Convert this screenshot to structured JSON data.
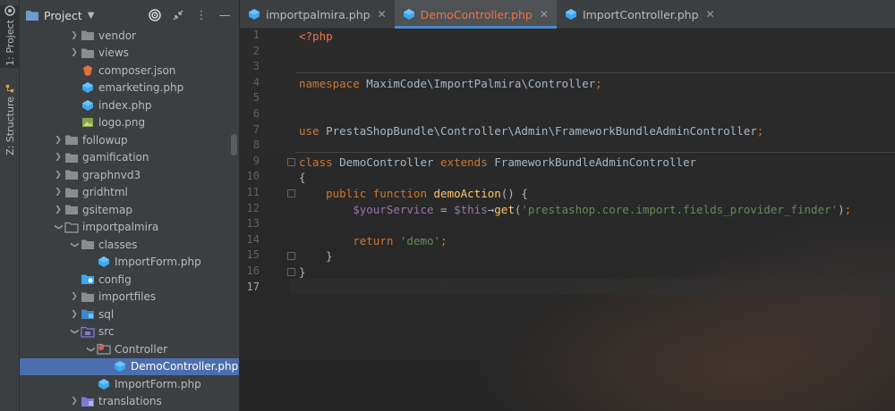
{
  "toolstrip": {
    "project_label": "1: Project",
    "structure_label": "Z: Structure"
  },
  "project_panel": {
    "title": "Project",
    "tree": [
      {
        "label": "vendor",
        "icon": "folder-icon",
        "depth": 3,
        "arrow": "collapsed"
      },
      {
        "label": "views",
        "icon": "folder-icon",
        "depth": 3,
        "arrow": "collapsed"
      },
      {
        "label": "composer.json",
        "icon": "json-file-icon",
        "depth": 3,
        "arrow": "none"
      },
      {
        "label": "emarketing.php",
        "icon": "php-file-icon",
        "depth": 3,
        "arrow": "none"
      },
      {
        "label": "index.php",
        "icon": "php-file-icon",
        "depth": 3,
        "arrow": "none"
      },
      {
        "label": "logo.png",
        "icon": "image-file-icon",
        "depth": 3,
        "arrow": "none"
      },
      {
        "label": "followup",
        "icon": "folder-icon",
        "depth": 2,
        "arrow": "collapsed"
      },
      {
        "label": "gamification",
        "icon": "folder-icon",
        "depth": 2,
        "arrow": "collapsed"
      },
      {
        "label": "graphnvd3",
        "icon": "folder-icon",
        "depth": 2,
        "arrow": "collapsed"
      },
      {
        "label": "gridhtml",
        "icon": "folder-icon",
        "depth": 2,
        "arrow": "collapsed"
      },
      {
        "label": "gsitemap",
        "icon": "folder-icon",
        "depth": 2,
        "arrow": "collapsed"
      },
      {
        "label": "importpalmira",
        "icon": "folder-open-icon",
        "depth": 2,
        "arrow": "expanded"
      },
      {
        "label": "classes",
        "icon": "folder-icon",
        "depth": 3,
        "arrow": "expanded"
      },
      {
        "label": "ImportForm.php",
        "icon": "php-file-icon",
        "depth": 4,
        "arrow": "none"
      },
      {
        "label": "config",
        "icon": "config-folder-icon",
        "depth": 3,
        "arrow": "none"
      },
      {
        "label": "importfiles",
        "icon": "folder-icon",
        "depth": 3,
        "arrow": "collapsed"
      },
      {
        "label": "sql",
        "icon": "sql-folder-icon",
        "depth": 3,
        "arrow": "collapsed"
      },
      {
        "label": "src",
        "icon": "src-folder-icon",
        "depth": 3,
        "arrow": "expanded"
      },
      {
        "label": "Controller",
        "icon": "controller-folder-icon",
        "depth": 4,
        "arrow": "expanded"
      },
      {
        "label": "DemoController.php",
        "icon": "php-file-icon",
        "depth": 5,
        "arrow": "none",
        "selected": true
      },
      {
        "label": "ImportForm.php",
        "icon": "php-file-icon",
        "depth": 4,
        "arrow": "none"
      },
      {
        "label": "translations",
        "icon": "translations-folder-icon",
        "depth": 3,
        "arrow": "collapsed"
      }
    ]
  },
  "tabs": [
    {
      "label": "importpalmira.php",
      "active": false
    },
    {
      "label": "DemoController.php",
      "active": true
    },
    {
      "label": "ImportController.php",
      "active": false
    }
  ],
  "editor": {
    "current_line": 17,
    "lines": [
      {
        "n": "1",
        "tokens": [
          {
            "t": "<?php",
            "c": "tag"
          }
        ]
      },
      {
        "n": "2",
        "tokens": []
      },
      {
        "n": "3",
        "tokens": []
      },
      {
        "n": "4",
        "tokens": [
          {
            "t": "namespace ",
            "c": "kw"
          },
          {
            "t": "MaximCode\\ImportPalmira\\Controller",
            "c": ""
          },
          {
            "t": ";",
            "c": "kw"
          }
        ]
      },
      {
        "n": "5",
        "tokens": []
      },
      {
        "n": "6",
        "tokens": []
      },
      {
        "n": "7",
        "tokens": [
          {
            "t": "use ",
            "c": "kw"
          },
          {
            "t": "PrestaShopBundle\\Controller\\Admin\\FrameworkBundleAdminController",
            "c": ""
          },
          {
            "t": ";",
            "c": "kw"
          }
        ]
      },
      {
        "n": "8",
        "tokens": []
      },
      {
        "n": "9",
        "tokens": [
          {
            "t": "class ",
            "c": "kw"
          },
          {
            "t": "DemoController ",
            "c": ""
          },
          {
            "t": "extends ",
            "c": "kw"
          },
          {
            "t": "FrameworkBundleAdminController",
            "c": ""
          }
        ]
      },
      {
        "n": "10",
        "tokens": [
          {
            "t": "{",
            "c": ""
          }
        ]
      },
      {
        "n": "11",
        "tokens": [
          {
            "t": "    public function ",
            "c": "kw"
          },
          {
            "t": "demoAction",
            "c": "fn"
          },
          {
            "t": "() {",
            "c": ""
          }
        ]
      },
      {
        "n": "12",
        "tokens": [
          {
            "t": "        $yourService",
            "c": "var"
          },
          {
            "t": " = ",
            "c": ""
          },
          {
            "t": "$this",
            "c": "var"
          },
          {
            "t": "→",
            "c": ""
          },
          {
            "t": "get",
            "c": "fn"
          },
          {
            "t": "(",
            "c": ""
          },
          {
            "t": "'prestashop.core.import.fields_provider_finder'",
            "c": "str"
          },
          {
            "t": ")",
            "c": ""
          },
          {
            "t": ";",
            "c": "kw"
          }
        ]
      },
      {
        "n": "13",
        "tokens": []
      },
      {
        "n": "14",
        "tokens": [
          {
            "t": "        return ",
            "c": "kw"
          },
          {
            "t": "'demo'",
            "c": "str"
          },
          {
            "t": ";",
            "c": "kw"
          }
        ]
      },
      {
        "n": "15",
        "tokens": [
          {
            "t": "    }",
            "c": ""
          }
        ]
      },
      {
        "n": "16",
        "tokens": [
          {
            "t": "}",
            "c": ""
          }
        ]
      },
      {
        "n": "17",
        "tokens": []
      }
    ]
  },
  "colors": {
    "accent_tab": "#4a88c7",
    "selected_row": "#4b6eaf",
    "keyword": "#cc7832",
    "function": "#ffc66d",
    "variable": "#9876aa",
    "string": "#6a8759"
  }
}
